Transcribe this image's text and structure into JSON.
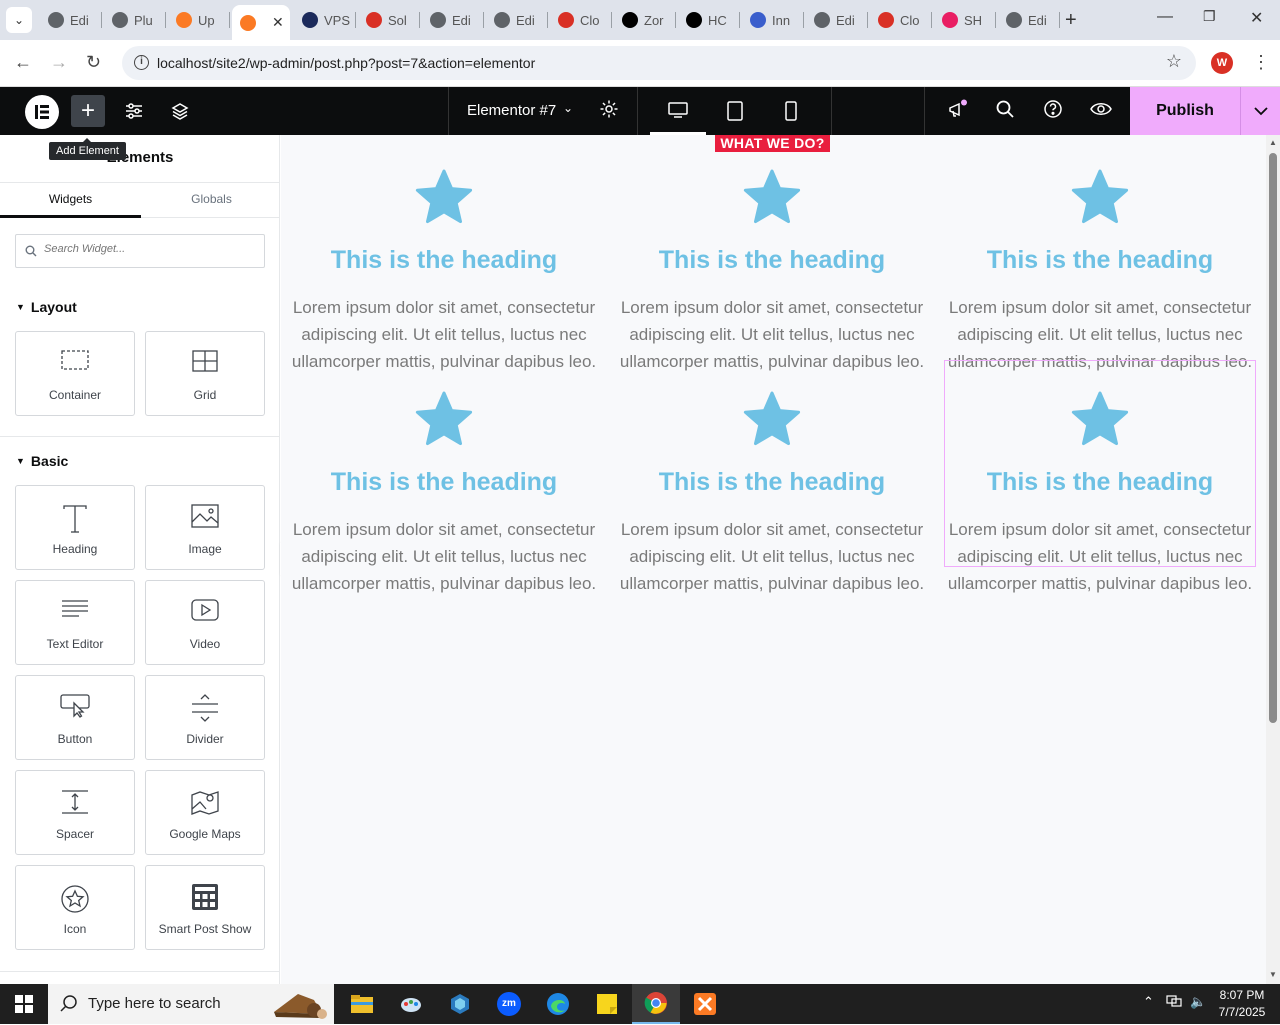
{
  "browser": {
    "tabs": [
      {
        "label": "Edi",
        "icon": "wordpress-icon",
        "color": "#5f6368"
      },
      {
        "label": "Plu",
        "icon": "wordpress-icon",
        "color": "#5f6368"
      },
      {
        "label": "Up",
        "icon": "xampp-icon",
        "color": "#fb7a24"
      },
      {
        "label": "",
        "icon": "xampp-icon",
        "color": "#fb7a24",
        "active": true
      },
      {
        "label": "VPS",
        "icon": "vps-icon",
        "color": "#1b2a5b"
      },
      {
        "label": "Sol",
        "icon": "solution-icon",
        "color": "#d93025"
      },
      {
        "label": "Edi",
        "icon": "wordpress-icon",
        "color": "#5f6368"
      },
      {
        "label": "Edi",
        "icon": "wordpress-icon",
        "color": "#5f6368"
      },
      {
        "label": "Clo",
        "icon": "cloud-icon",
        "color": "#d93025"
      },
      {
        "label": "Zor",
        "icon": "zoro-icon",
        "color": "#000000"
      },
      {
        "label": "HC",
        "icon": "openai-icon",
        "color": "#000000"
      },
      {
        "label": "Inn",
        "icon": "inn-icon",
        "color": "#3a5ecc"
      },
      {
        "label": "Edi",
        "icon": "wordpress-icon",
        "color": "#5f6368"
      },
      {
        "label": "Clo",
        "icon": "claude-icon",
        "color": "#d93025"
      },
      {
        "label": "SH",
        "icon": "sh-icon",
        "color": "#e91e63"
      },
      {
        "label": "Edi",
        "icon": "wordpress-icon",
        "color": "#5f6368"
      }
    ],
    "url": "localhost/site2/wp-admin/post.php?post=7&action=elementor",
    "profile_initial": "W"
  },
  "editor": {
    "document_title": "Elementor #7",
    "publish_label": "Publish",
    "tooltip": "Add Element",
    "accent": "#f0abfc"
  },
  "panel": {
    "title": "Elements",
    "tabs": [
      "Widgets",
      "Globals"
    ],
    "search_placeholder": "Search Widget...",
    "layout_label": "Layout",
    "basic_label": "Basic",
    "layout_widgets": [
      {
        "label": "Container",
        "icon": "container-icon"
      },
      {
        "label": "Grid",
        "icon": "grid-icon"
      }
    ],
    "basic_widgets": [
      {
        "label": "Heading",
        "icon": "heading-icon"
      },
      {
        "label": "Image",
        "icon": "image-icon"
      },
      {
        "label": "Text Editor",
        "icon": "text-editor-icon"
      },
      {
        "label": "Video",
        "icon": "video-icon"
      },
      {
        "label": "Button",
        "icon": "button-icon"
      },
      {
        "label": "Divider",
        "icon": "divider-icon"
      },
      {
        "label": "Spacer",
        "icon": "spacer-icon"
      },
      {
        "label": "Google Maps",
        "icon": "google-maps-icon"
      },
      {
        "label": "Icon",
        "icon": "icon-widget-icon"
      },
      {
        "label": "Smart Post Show",
        "icon": "smart-post-show-icon"
      }
    ]
  },
  "canvas": {
    "section_badge": "WHAT WE DO?",
    "boxes": [
      {
        "heading": "This is the heading",
        "text": "Lorem ipsum dolor sit amet, consectetur adipiscing elit. Ut elit tellus, luctus nec ullamcorper mattis, pulvinar dapibus leo."
      },
      {
        "heading": "This is the heading",
        "text": "Lorem ipsum dolor sit amet, consectetur adipiscing elit. Ut elit tellus, luctus nec ullamcorper mattis, pulvinar dapibus leo."
      },
      {
        "heading": "This is the heading",
        "text": "Lorem ipsum dolor sit amet, consectetur adipiscing elit. Ut elit tellus, luctus nec ullamcorper mattis, pulvinar dapibus leo."
      },
      {
        "heading": "This is the heading",
        "text": "Lorem ipsum dolor sit amet, consectetur adipiscing elit. Ut elit tellus, luctus nec ullamcorper mattis, pulvinar dapibus leo."
      },
      {
        "heading": "This is the heading",
        "text": "Lorem ipsum dolor sit amet, consectetur adipiscing elit. Ut elit tellus, luctus nec ullamcorper mattis, pulvinar dapibus leo."
      },
      {
        "heading": "This is the heading",
        "text": "Lorem ipsum dolor sit amet, consectetur adipiscing elit. Ut elit tellus, luctus nec ullamcorper mattis, pulvinar dapibus leo.",
        "selected": true
      }
    ],
    "heading_color": "#6ec1e4",
    "star_color": "#6ec1e4"
  },
  "taskbar": {
    "search_placeholder": "Type here to search",
    "time": "8:07 PM",
    "date": "7/7/2025"
  }
}
